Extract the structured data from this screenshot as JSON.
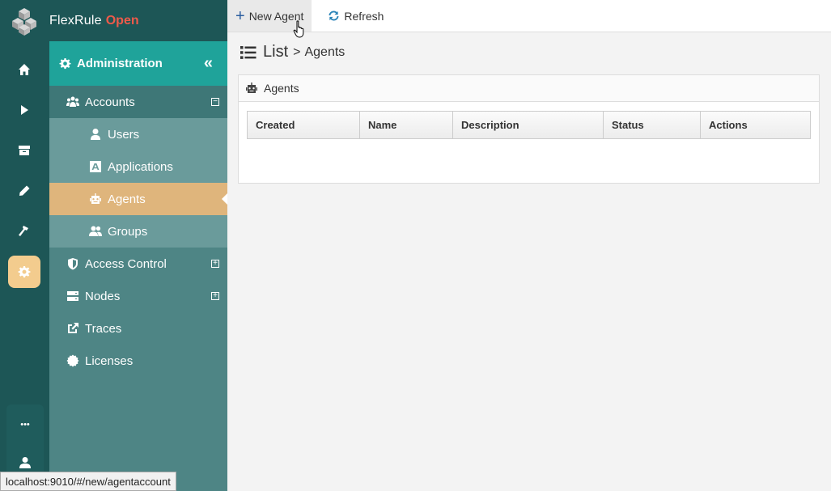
{
  "brand": {
    "name": "FlexRule",
    "edition": "Open"
  },
  "rail": {
    "items": [
      {
        "icon": "home-icon"
      },
      {
        "icon": "play-icon"
      },
      {
        "icon": "archive-icon"
      },
      {
        "icon": "pencil-icon"
      },
      {
        "icon": "hammer-icon"
      },
      {
        "icon": "gear-icon",
        "active": true
      }
    ],
    "more_label": "•••"
  },
  "sidebar": {
    "title": "Administration",
    "collapse_label": "«",
    "items": [
      {
        "label": "Accounts",
        "toggle": "−"
      },
      {
        "label": "Users"
      },
      {
        "label": "Applications"
      },
      {
        "label": "Agents"
      },
      {
        "label": "Groups"
      },
      {
        "label": "Access Control",
        "toggle": "+"
      },
      {
        "label": "Nodes",
        "toggle": "+"
      },
      {
        "label": "Traces"
      },
      {
        "label": "Licenses"
      }
    ]
  },
  "toolbar": {
    "new_label": "New Agent",
    "new_icon": "+",
    "refresh_label": "Refresh"
  },
  "breadcrumb": {
    "list": "List",
    "sep": ">",
    "current": "Agents"
  },
  "panel": {
    "title": "Agents"
  },
  "table": {
    "columns": [
      "Created",
      "Name",
      "Description",
      "Status",
      "Actions"
    ]
  },
  "status_url": "localhost:9010/#/new/agentaccount",
  "colors": {
    "rail": "#1d5656",
    "sidebar": "#4e8585",
    "header": "#1fa39a",
    "selected": "#dfb57c",
    "brand_accent": "#ee5a4a"
  }
}
